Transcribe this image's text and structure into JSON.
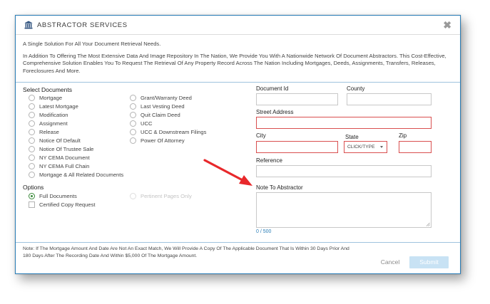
{
  "dialog": {
    "title": "ABSTRACTOR SERVICES",
    "icon": "bank-building-icon",
    "close_label": "✖"
  },
  "intro": {
    "line1": "A Single Solution For All Your Document Retrieval Needs.",
    "line2": "In Addition To Offering The Most Extensive Data And Image Repository In The Nation, We Provide You With A Nationwide Network Of Document Abstractors. This Cost-Effective, Comprehensive Solution Enables You To Request The Retrieval Of Any Property Record Across The Nation Including Mortgages, Deeds, Assignments, Transfers, Releases, Foreclosures And More."
  },
  "documents": {
    "title": "Select Documents",
    "col1": [
      "Mortgage",
      "Latest Mortgage",
      "Modification",
      "Assignment",
      "Release",
      "Notice Of Default",
      "Notice Of Trustee Sale",
      "NY CEMA Document",
      "NY CEMA Full Chain",
      "Mortgage & All Related Documents"
    ],
    "col2": [
      "Grant/Warranty Deed",
      "Last Vesting Deed",
      "Quit Claim Deed",
      "UCC",
      "UCC & Downstream Filings",
      "Power Of Attorney"
    ]
  },
  "options": {
    "title": "Options",
    "full_documents": "Full Documents",
    "pertinent_pages": "Pertinent Pages Only",
    "certified_copy": "Certified Copy Request"
  },
  "form": {
    "document_id_label": "Document Id",
    "county_label": "County",
    "street_label": "Street Address",
    "city_label": "City",
    "state_label": "State",
    "state_value": "CLICK/TYPE",
    "zip_label": "Zip",
    "reference_label": "Reference",
    "note_label": "Note To Abstractor",
    "note_counter": "0 / 500"
  },
  "footer": {
    "note": "Note: If The Mortgage Amount And Date Are Not An Exact Match, We Will Provide A Copy Of The Applicable Document That Is Within 30 Days Prior And 180 Days After The Recording Date And Within $5,000 Of The Mortgage Amount.",
    "cancel": "Cancel",
    "submit": "Submit"
  },
  "colors": {
    "accent": "#2c7fb8",
    "required_border": "#d94f4f",
    "arrow": "#e8282b",
    "submit_disabled": "#c8e2f4"
  }
}
